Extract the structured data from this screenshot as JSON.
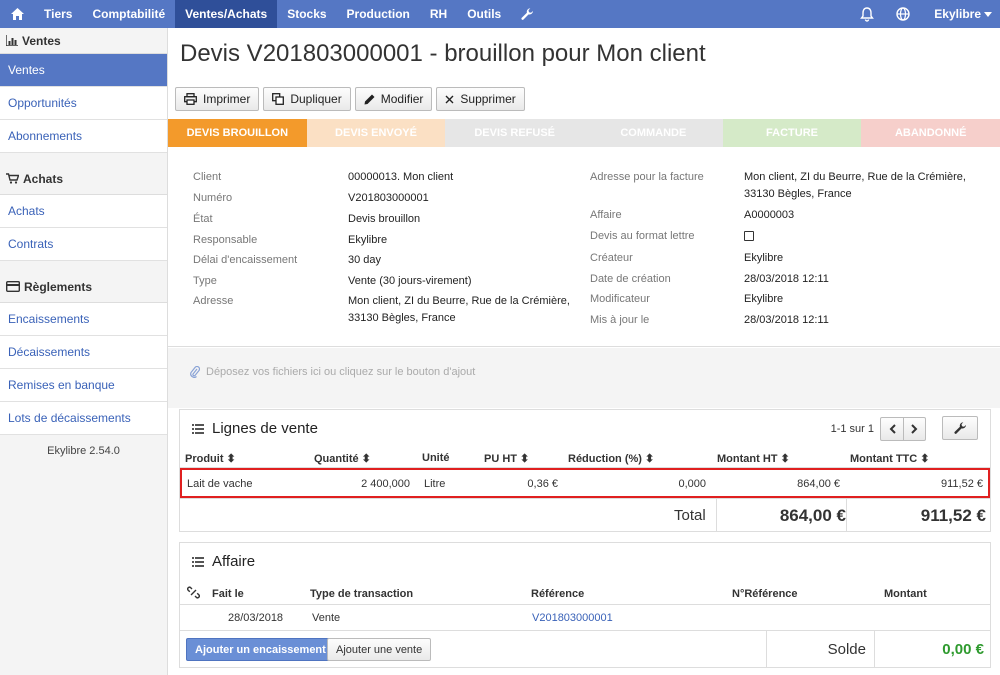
{
  "topnav": {
    "items": [
      "Tiers",
      "Comptabilité",
      "Ventes/Achats",
      "Stocks",
      "Production",
      "RH",
      "Outils"
    ],
    "user": "Ekylibre"
  },
  "sidebar": {
    "ventes_title": "Ventes",
    "ventes_items": [
      "Ventes",
      "Opportunités",
      "Abonnements"
    ],
    "achats_title": "Achats",
    "achats_items": [
      "Achats",
      "Contrats"
    ],
    "reglements_title": "Règlements",
    "reglements_items": [
      "Encaissements",
      "Décaissements",
      "Remises en banque",
      "Lots de décaissements"
    ],
    "version": "Ekylibre 2.54.0"
  },
  "page": {
    "title": "Devis V201803000001 - brouillon pour Mon client"
  },
  "toolbar": {
    "print": "Imprimer",
    "duplicate": "Dupliquer",
    "edit": "Modifier",
    "delete": "Supprimer"
  },
  "steps": [
    {
      "label": "Devis brouillon",
      "color": "#f39a2b"
    },
    {
      "label": "Devis envoyé",
      "color": "#fbe0c4"
    },
    {
      "label": "Devis refusé",
      "color": "#e6e6e6"
    },
    {
      "label": "Commande",
      "color": "#e6e6e6"
    },
    {
      "label": "Facture",
      "color": "#d5eac8"
    },
    {
      "label": "Abandonné",
      "color": "#f6cfcb"
    }
  ],
  "info": {
    "client_k": "Client",
    "client_v": "00000013. Mon client",
    "numero_k": "Numéro",
    "numero_v": "V201803000001",
    "etat_k": "État",
    "etat_v": "Devis brouillon",
    "responsable_k": "Responsable",
    "responsable_v": "Ekylibre",
    "delai_k": "Délai d'encaissement",
    "delai_v": "30 day",
    "type_k": "Type",
    "type_v": "Vente (30 jours-virement)",
    "adresse_k": "Adresse",
    "adresse_v1": "Mon client, ZI du Beurre, Rue de la Crémière,",
    "adresse_v2": "33130 Bègles, France",
    "adr_fact_k": "Adresse pour la facture",
    "adr_fact_v1": "Mon client, ZI du Beurre, Rue de la Crémière,",
    "adr_fact_v2": "33130 Bègles, France",
    "affaire_k": "Affaire",
    "affaire_v": "A0000003",
    "lettre_k": "Devis au format lettre",
    "createur_k": "Créateur",
    "createur_v": "Ekylibre",
    "date_creation_k": "Date de création",
    "date_creation_v": "28/03/2018 12:11",
    "modificateur_k": "Modificateur",
    "modificateur_v": "Ekylibre",
    "maj_k": "Mis à jour le",
    "maj_v": "28/03/2018 12:11"
  },
  "dropzone": "Déposez vos fichiers ici ou cliquez sur le bouton d'ajout",
  "sales": {
    "title": "Lignes de vente",
    "pager": "1-1 sur 1",
    "columns": [
      "Produit",
      "Quantité",
      "Unité",
      "PU HT",
      "Réduction (%)",
      "Montant HT",
      "Montant TTC"
    ],
    "row": {
      "produit": "Lait de vache",
      "quantite": "2 400,000",
      "unite": "Litre",
      "pu_ht": "0,36 €",
      "reduction": "0,000",
      "montant_ht": "864,00 €",
      "montant_ttc": "911,52 €"
    },
    "total_label": "Total",
    "total_ht": "864,00 €",
    "total_ttc": "911,52 €"
  },
  "affaire": {
    "title": "Affaire",
    "columns": [
      "Fait le",
      "Type de transaction",
      "Référence",
      "N°Référence",
      "Montant"
    ],
    "row": {
      "date": "28/03/2018",
      "type": "Vente",
      "reference": "V201803000001"
    },
    "add_payment": "Ajouter un encaissement",
    "add_sale": "Ajouter une vente",
    "solde_label": "Solde",
    "solde_value": "0,00 €"
  },
  "colors": {
    "nav": "#5577c4",
    "nav_active": "#2f4f99",
    "link": "#3a62b8",
    "solde": "#2e9a2e",
    "highlight": "#e02020"
  }
}
